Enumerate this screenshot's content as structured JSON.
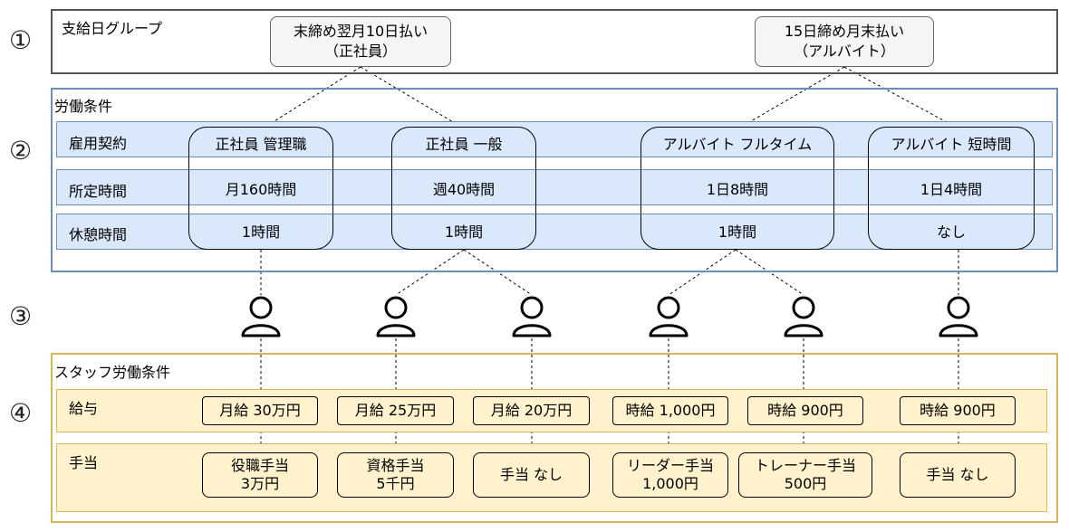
{
  "markers": [
    "①",
    "②",
    "③",
    "④"
  ],
  "section1": {
    "title": "支給日グループ",
    "groups": [
      "末締め翌月10日払い\n（正社員）",
      "15日締め月末払い\n（アルバイト）"
    ]
  },
  "section2": {
    "title": "労働条件",
    "row_labels": [
      "雇用契約",
      "所定時間",
      "休憩時間"
    ],
    "contracts": [
      {
        "name": "正社員 管理職",
        "hours": "月160時間",
        "break": "1時間"
      },
      {
        "name": "正社員 一般",
        "hours": "週40時間",
        "break": "1時間"
      },
      {
        "name": "アルバイト フルタイム",
        "hours": "1日8時間",
        "break": "1時間"
      },
      {
        "name": "アルバイト 短時間",
        "hours": "1日4時間",
        "break": "なし"
      }
    ]
  },
  "section4": {
    "title": "スタッフ労働条件",
    "row_labels": [
      "給与",
      "手当"
    ],
    "salaries": [
      "月給 30万円",
      "月給 25万円",
      "月給 20万円",
      "時給 1,000円",
      "時給 900円",
      "時給 900円"
    ],
    "allowances": [
      "役職手当\n3万円",
      "資格手当\n5千円",
      "手当 なし",
      "リーダー手当\n1,000円",
      "トレーナー手当\n500円",
      "手当 なし"
    ]
  }
}
